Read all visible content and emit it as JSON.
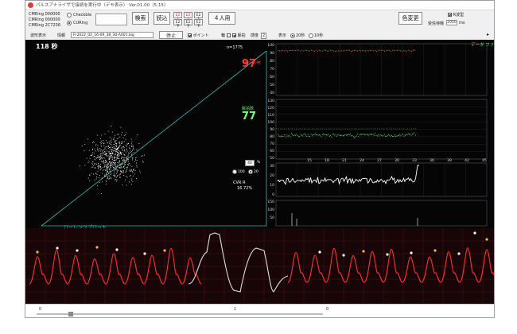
{
  "window": {
    "title": "パルスアナライザで接続を実行中（デモ表示） Ver.01.00（5.15）"
  },
  "ids": [
    "CMRing 000000",
    "CMRing 000000",
    "CMRing 2C7236"
  ],
  "source_options": [
    {
      "label": "Checkble",
      "selected": false
    },
    {
      "label": "CURing",
      "selected": true
    }
  ],
  "buttons": {
    "search": "検索",
    "read": "読込",
    "four_person": "４人用",
    "color_change": "色変更"
  },
  "small_buttons": [
    {
      "label": "E2上",
      "accent": true
    },
    {
      "label": "E2下",
      "accent": false
    },
    {
      "label": "E2上",
      "accent": true
    },
    {
      "label": "E2下",
      "accent": false
    },
    {
      "label": "E2上",
      "accent": false
    },
    {
      "label": "E2下",
      "accent": false
    }
  ],
  "right_options": {
    "checkbox_label": "R波型",
    "receive_label": "受信待機",
    "receive_value": "2000",
    "unit": "ms"
  },
  "row2": {
    "wave_label": "波形表示",
    "info_label": "情報",
    "file_name": "R-2022_02_16-09_38_30-A001.log",
    "stop": "停止",
    "point_label": "ポイント",
    "kind_label": "輪",
    "group_label": "脈拍",
    "second_label": "感度",
    "second_value": "2",
    "display_label": "表示",
    "range_a": "20秒",
    "range_b": "10秒"
  },
  "scatter": {
    "count_label": "118 秒",
    "n_label": "n=1775",
    "plot_label": "ローレンツプロット"
  },
  "metrics": {
    "heart_rate_label": "Heart心拍",
    "heart_rate_value": "97",
    "rate_label": "脈拍数",
    "rate_value": "77",
    "cvrr_label": "CVR R",
    "cvrr_value": "16.72%"
  },
  "panels": {
    "display_name": "データ ファイル表示中",
    "hr_ticks": [
      "100",
      "90",
      "80",
      "70",
      "60",
      "50",
      "40"
    ],
    "rate_ticks": [
      "130",
      "120",
      "110",
      "100",
      "90",
      "80",
      "70",
      "60",
      "50"
    ],
    "rr_ticks": [
      "30",
      "20",
      "10",
      "0"
    ],
    "time_ticks": [
      "15",
      "18",
      "21",
      "24",
      "27",
      "30",
      "33",
      "36",
      "39",
      "42",
      "45"
    ],
    "lower_ticks": [
      "150",
      "100",
      "50"
    ]
  },
  "rr_controls": {
    "field_value": "40",
    "unit": "%",
    "option_a": "100",
    "option_b": "20"
  },
  "waveform": {
    "bottom_labels": [
      "0",
      "1",
      "0"
    ]
  },
  "colors": {
    "hr_red": "#ff3b3b",
    "rate_green": "#7fff7f",
    "lorenz_cyan": "#40d0d0",
    "wave_red": "#ff3030",
    "wave_white": "#e0e0e0"
  }
}
